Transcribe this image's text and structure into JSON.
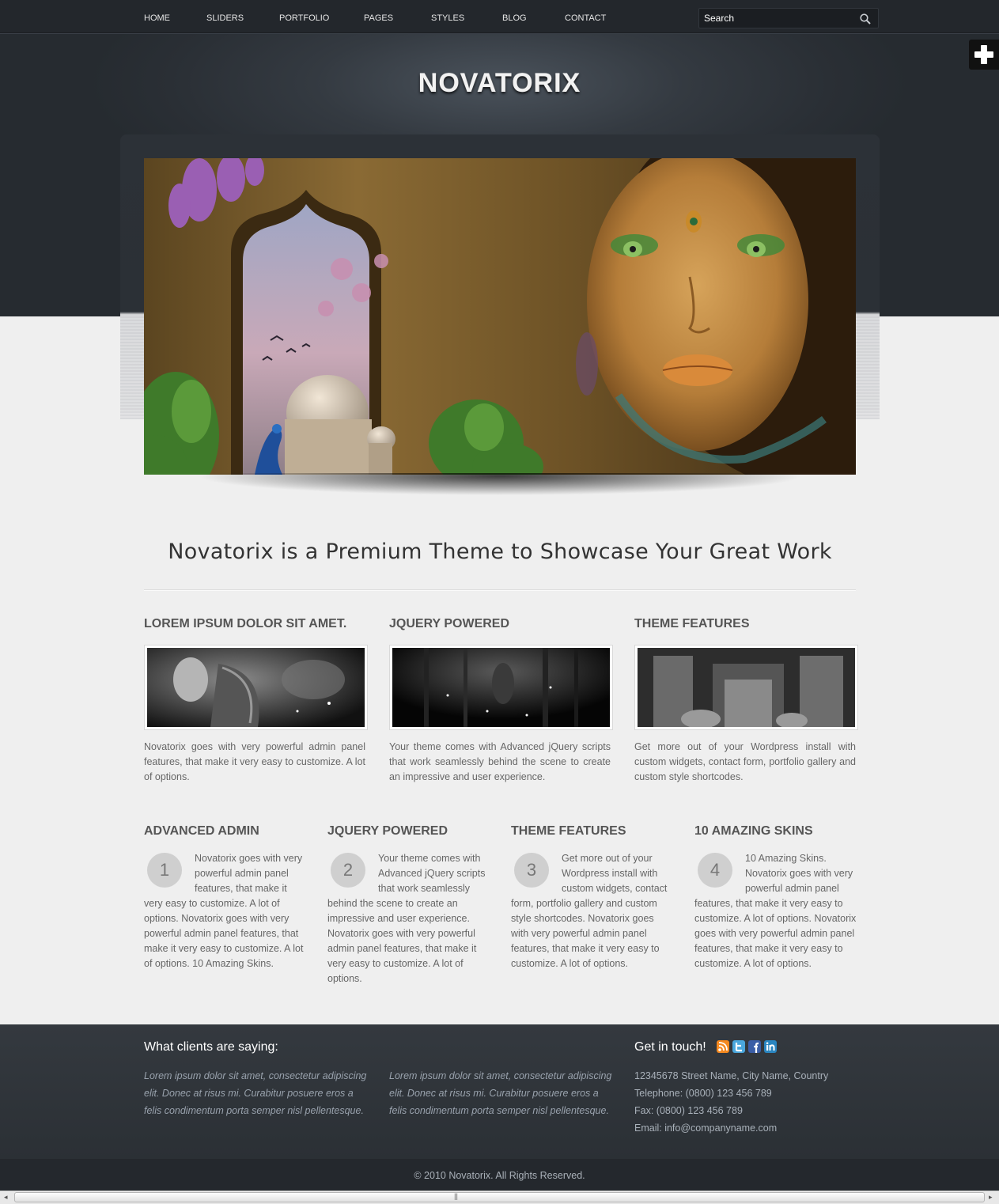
{
  "nav": {
    "items": [
      "HOME",
      "SLIDERS",
      "PORTFOLIO",
      "PAGES",
      "STYLES",
      "BLOG",
      "CONTACT"
    ],
    "search_placeholder": "Search"
  },
  "brand": {
    "logo": "NOVATORIX"
  },
  "hero": {
    "headline": "Novatorix is a Premium Theme to Showcase Your Great Work"
  },
  "features": [
    {
      "title": "LOREM IPSUM DOLOR SIT AMET.",
      "text": "Novatorix goes with very powerful admin panel features, that make it very easy to customize. A lot of options."
    },
    {
      "title": "JQUERY POWERED",
      "text": "Your theme comes with Advanced jQuery scripts that work seamlessly behind the scene to create an impressive and user experience."
    },
    {
      "title": "THEME FEATURES",
      "text": "Get more out of your Wordpress install with custom widgets, contact form, portfolio gallery and custom style shortcodes."
    }
  ],
  "numbered": [
    {
      "title": "ADVANCED ADMIN",
      "number": "1",
      "text": "Novatorix goes with very powerful admin panel features, that make it very easy to customize. A lot of options. Novatorix goes with very powerful admin panel features, that make it very easy to customize. A lot of options. 10 Amazing Skins."
    },
    {
      "title": "JQUERY POWERED",
      "number": "2",
      "text": "Your theme comes with Advanced jQuery scripts that work seamlessly behind the scene to create an impressive and user experience. Novatorix goes with very powerful admin panel features, that make it very easy to customize. A lot of options."
    },
    {
      "title": "THEME FEATURES",
      "number": "3",
      "text": "Get more out of your Wordpress install with custom widgets, contact form, portfolio gallery and custom style shortcodes. Novatorix goes with very powerful admin panel features, that make it very easy to customize. A lot of options."
    },
    {
      "title": "10 AMAZING SKINS",
      "number": "4",
      "text": "10 Amazing Skins. Novatorix goes with very powerful admin panel features, that make it very easy to customize. A lot of options. Novatorix goes with very powerful admin panel features, that make it very easy to customize. A lot of options."
    }
  ],
  "footer": {
    "testimonials_title": "What clients are saying:",
    "quotes": [
      "Lorem ipsum dolor sit amet, consectetur adipiscing elit. Donec at risus mi. Curabitur posuere eros a felis condimentum porta semper nisl pellentesque.",
      "Lorem ipsum dolor sit amet, consectetur adipiscing elit. Donec at risus mi. Curabitur posuere eros a felis condimentum porta semper nisl pellentesque."
    ],
    "contact_title": "Get in touch!",
    "social_icons": [
      "rss-icon",
      "twitter-icon",
      "facebook-icon",
      "linkedin-icon"
    ],
    "social_colors": [
      "#f5891f",
      "#4aa7dd",
      "#3b5ea6",
      "#2a86c1"
    ],
    "address": "12345678 Street Name, City Name, Country",
    "telephone": "Telephone: (0800) 123 456 789",
    "fax": "Fax: (0800) 123 456 789",
    "email": "Email: info@companyname.com",
    "copyright": "© 2010 Novatorix. All Rights Reserved."
  }
}
